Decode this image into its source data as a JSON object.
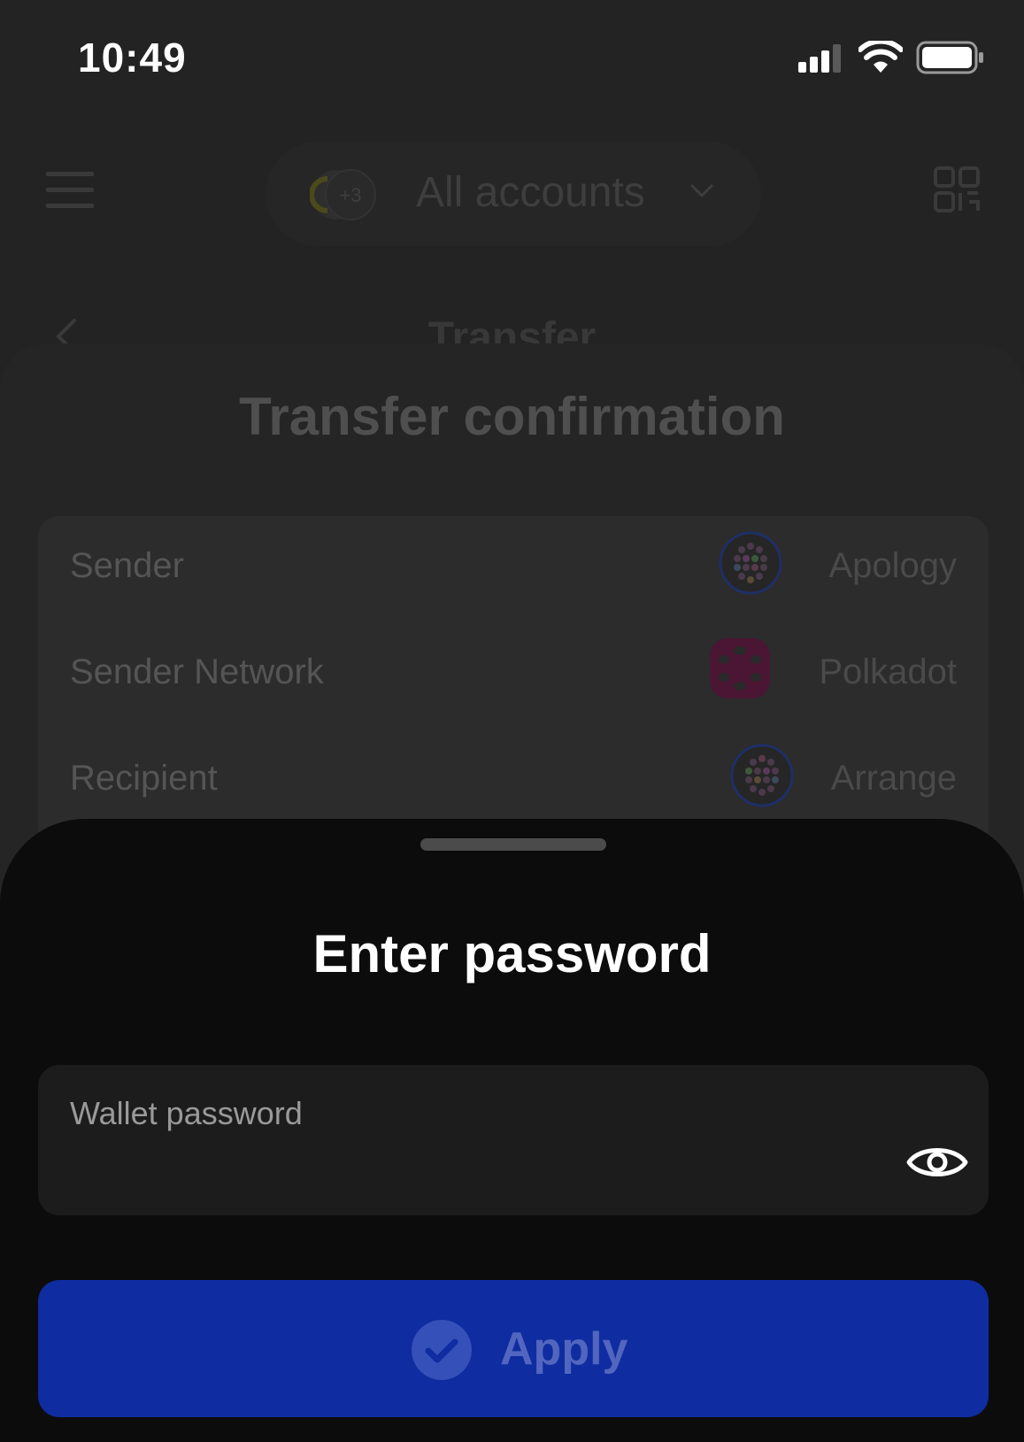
{
  "status_bar": {
    "time": "10:49",
    "signal_icon": "cellular-signal-icon",
    "wifi_icon": "wifi-icon",
    "battery_icon": "battery-full-icon"
  },
  "header": {
    "menu_icon": "hamburger-menu-icon",
    "account_selector": "All accounts",
    "avatar_badge": "+3",
    "qr_icon": "qr-scan-icon"
  },
  "transfer_screen": {
    "title": "Transfer",
    "back_icon": "chevron-left-icon"
  },
  "confirmation": {
    "title": "Transfer confirmation",
    "rows": [
      {
        "label": "Sender",
        "value": "Apology",
        "icon": "account-identicon"
      },
      {
        "label": "Sender Network",
        "value": "Polkadot",
        "icon": "polkadot-logo-icon"
      },
      {
        "label": "Recipient",
        "value": "Arrange",
        "icon": "account-identicon"
      }
    ]
  },
  "password_sheet": {
    "title": "Enter password",
    "field_label": "Wallet password",
    "field_value": "",
    "eye_icon": "eye-icon",
    "apply_label": "Apply",
    "apply_icon": "check-circle-icon"
  },
  "colors": {
    "overlay_background": "#232323",
    "sheet_background": "#0c0c0c",
    "field_background": "#1c1c1c",
    "apply_button": "#0f2da0",
    "apply_text": "#5266c0",
    "polkadot_pink": "#e6007a"
  }
}
